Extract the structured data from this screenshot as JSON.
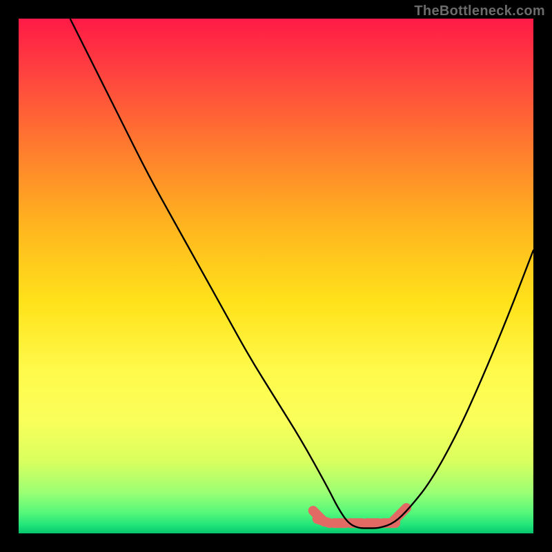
{
  "watermark": "TheBottleneck.com",
  "chart_data": {
    "type": "line",
    "title": "",
    "xlabel": "",
    "ylabel": "",
    "xlim": [
      0,
      100
    ],
    "ylim": [
      0,
      100
    ],
    "grid": false,
    "series": [
      {
        "name": "curve",
        "x": [
          10,
          15,
          20,
          25,
          30,
          35,
          40,
          45,
          50,
          55,
          60,
          62,
          64,
          66,
          68,
          70,
          73,
          76,
          80,
          85,
          90,
          95,
          100
        ],
        "values": [
          100,
          90,
          80,
          70,
          61,
          52,
          43,
          34,
          26,
          18,
          9,
          5,
          2,
          1,
          1,
          1,
          2,
          5,
          10,
          19,
          30,
          42,
          55
        ]
      }
    ],
    "highlight_flat_region": {
      "x_start": 58,
      "x_end": 74,
      "y": 2
    },
    "background_gradient": {
      "top": "#ff1a46",
      "mid": "#ffe21a",
      "bottom": "#06c46c"
    }
  }
}
